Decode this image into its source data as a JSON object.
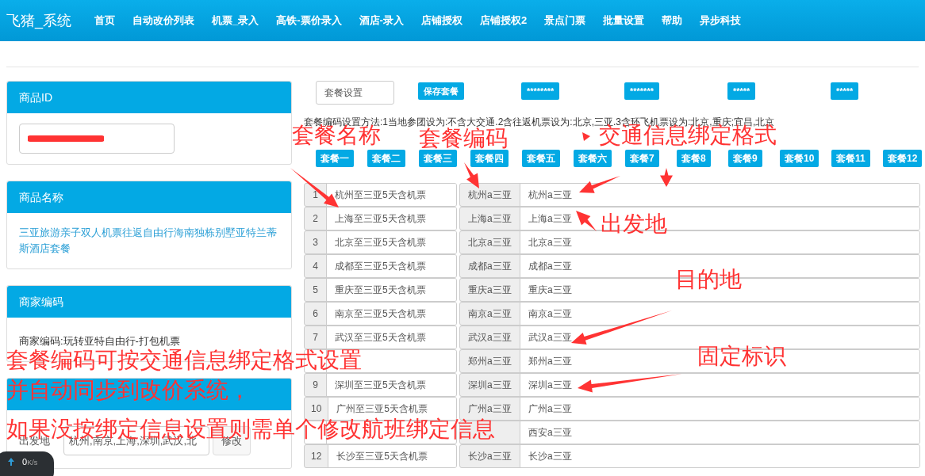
{
  "navbar": {
    "brand": "飞猪_系统",
    "items": [
      "首页",
      "自动改价列表",
      "机票_录入",
      "高铁-票价录入",
      "酒店-录入",
      "店铺授权",
      "店铺授权2",
      "景点门票",
      "批量设置",
      "帮助",
      "异步科技"
    ]
  },
  "sidebar": [
    {
      "kind": "input",
      "title": "商品ID",
      "redacted": true
    },
    {
      "kind": "link",
      "title": "商品名称",
      "text": "三亚旅游亲子双人机票往返自由行海南独栋别墅亚特兰蒂斯酒店套餐"
    },
    {
      "kind": "text",
      "title": "商家编码",
      "text": "商家编码:玩转亚特自由行-打包机票"
    },
    {
      "kind": "form",
      "label": "出发地",
      "value": "杭州,南京,上海,深圳,武汉,北",
      "button": "修改"
    }
  ],
  "toolbar": {
    "field_value": "套餐设置",
    "buttons": [
      "保存套餐",
      "********",
      "*******",
      "*****",
      "*****"
    ]
  },
  "hint": "套餐编码设置方法:1当地参团设为:不含大交通.2含往返机票设为:北京,三亚.3含环飞机票设为:北京,重庆;宜昌,北京",
  "package_tabs": [
    "套餐一",
    "套餐二",
    "套餐三",
    "套餐四",
    "套餐五",
    "套餐六",
    "套餐7",
    "套餐8",
    "套餐9",
    "套餐10",
    "套餐11",
    "套餐12"
  ],
  "rows": [
    {
      "number": "1",
      "name": "杭州至三亚5天含机票",
      "code": "杭州a三亚",
      "binding": "杭州a三亚"
    },
    {
      "number": "2",
      "name": "上海至三亚5天含机票",
      "code": "上海a三亚",
      "binding": "上海a三亚"
    },
    {
      "number": "3",
      "name": "北京至三亚5天含机票",
      "code": "北京a三亚",
      "binding": "北京a三亚"
    },
    {
      "number": "4",
      "name": "成都至三亚5天含机票",
      "code": "成都a三亚",
      "binding": "成都a三亚"
    },
    {
      "number": "5",
      "name": "重庆至三亚5天含机票",
      "code": "重庆a三亚",
      "binding": "重庆a三亚"
    },
    {
      "number": "6",
      "name": "南京至三亚5天含机票",
      "code": "南京a三亚",
      "binding": "南京a三亚"
    },
    {
      "number": "7",
      "name": "武汉至三亚5天含机票",
      "code": "武汉a三亚",
      "binding": "武汉a三亚"
    },
    {
      "code": "郑州a三亚",
      "binding": "郑州a三亚"
    },
    {
      "number": "9",
      "name": "深圳至三亚5天含机票",
      "code": "深圳a三亚",
      "binding": "深圳a三亚"
    },
    {
      "number": "10",
      "name": "广州至三亚5天含机票",
      "code": "广州a三亚",
      "binding": "广州a三亚"
    },
    {
      "binding": "西安a三亚"
    },
    {
      "number": "12",
      "name": "长沙至三亚5天含机票",
      "code": "长沙a三亚",
      "binding": "长沙a三亚"
    }
  ],
  "annotations": [
    "套餐名称",
    "套餐编码",
    "交通信息绑定格式",
    "出发地",
    "目的地",
    "固定标识",
    "套餐编码可按交通信息绑定格式设置",
    "并自动同步到改价系统，",
    "如果没按绑定信息设置则需单个修改航班绑定信息"
  ],
  "speed_widget": {
    "value": "0",
    "unit": "K/s"
  }
}
